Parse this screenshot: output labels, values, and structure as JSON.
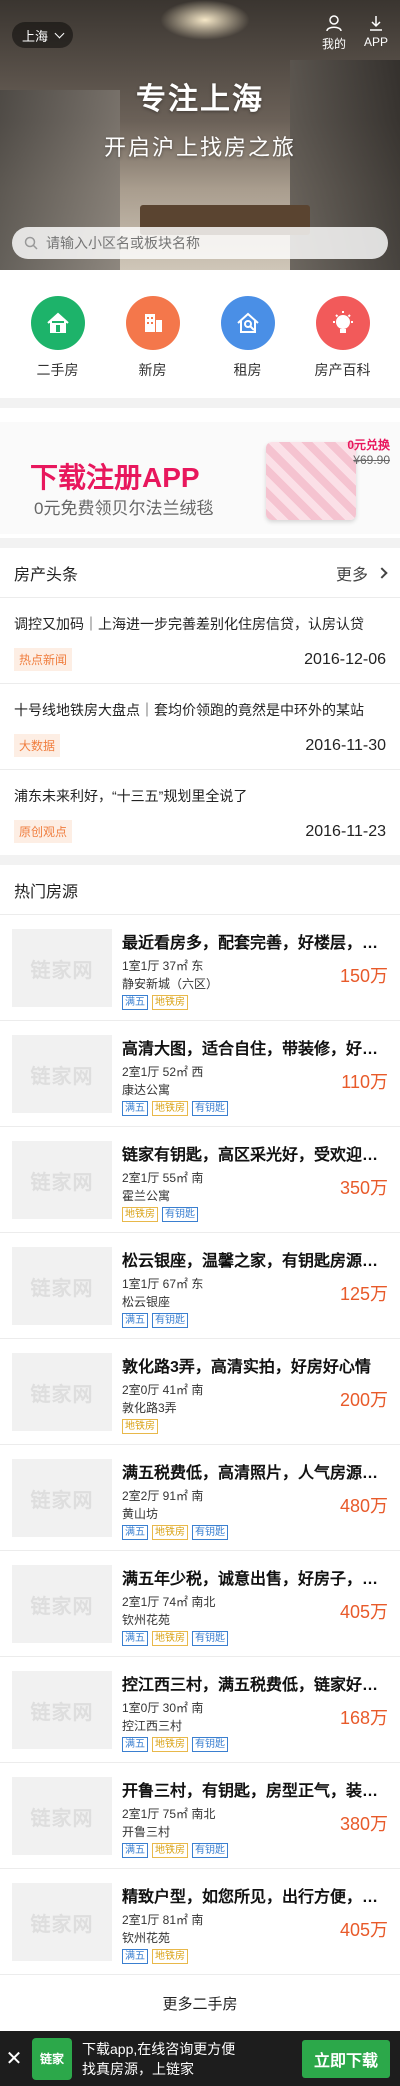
{
  "header": {
    "city": "上海",
    "my_label": "我的",
    "app_label": "APP",
    "title": "专注上海",
    "subtitle": "开启沪上找房之旅",
    "search_placeholder": "请输入小区名或板块名称"
  },
  "categories": [
    {
      "label": "二手房",
      "icon": "house-icon",
      "color": "#1db36a"
    },
    {
      "label": "新房",
      "icon": "building-icon",
      "color": "#f4774b"
    },
    {
      "label": "租房",
      "icon": "key-house-icon",
      "color": "#4a8fe6"
    },
    {
      "label": "房产百科",
      "icon": "bulb-icon",
      "color": "#f25a5a"
    }
  ],
  "banner": {
    "title": "下载注册APP",
    "subtitle": "0元免费领贝尔法兰绒毯",
    "promo_price": "0元兑换",
    "promo_original": "¥69.90"
  },
  "news": {
    "title": "房产头条",
    "more": "更多",
    "items": [
      {
        "title": "调控又加码｜上海进一步完善差别化住房信贷，认房认贷",
        "tag": "热点新闻",
        "date": "2016-12-06"
      },
      {
        "title": "十号线地铁房大盘点｜套均价领跑的竟然是中环外的某站",
        "tag": "大数据",
        "date": "2016-11-30"
      },
      {
        "title": "浦东未来利好，“十三五”规划里全说了",
        "tag": "原创观点",
        "date": "2016-11-23"
      }
    ]
  },
  "listings": {
    "title": "热门房源",
    "thumb_placeholder": "链家网",
    "items": [
      {
        "title": "最近看房多，配套完善，好楼层，采光好",
        "spec": "1室1厅 37㎡ 东",
        "community": "静安新城（六区）",
        "tags": [
          {
            "t": "满五",
            "c": "blue"
          },
          {
            "t": "地铁房",
            "c": "yellow"
          }
        ],
        "price": "150万"
      },
      {
        "title": "高清大图，适合自住，带装修，好楼层",
        "spec": "2室1厅 52㎡ 西",
        "community": "康达公寓",
        "tags": [
          {
            "t": "满五",
            "c": "blue"
          },
          {
            "t": "地铁房",
            "c": "yellow"
          },
          {
            "t": "有钥匙",
            "c": "blue"
          }
        ],
        "price": "110万"
      },
      {
        "title": "链家有钥匙，高区采光好，受欢迎房源",
        "spec": "2室1厅 55㎡ 南",
        "community": "霍兰公寓",
        "tags": [
          {
            "t": "地铁房",
            "c": "yellow"
          },
          {
            "t": "有钥匙",
            "c": "blue"
          }
        ],
        "price": "350万"
      },
      {
        "title": "松云银座，温馨之家，有钥匙房源，随时看",
        "spec": "1室1厅 67㎡ 东",
        "community": "松云银座",
        "tags": [
          {
            "t": "满五",
            "c": "blue"
          },
          {
            "t": "有钥匙",
            "c": "blue"
          }
        ],
        "price": "125万"
      },
      {
        "title": "敦化路3弄，高清实拍，好房好心情",
        "spec": "2室0厅 41㎡ 南",
        "community": "敦化路3弄",
        "tags": [
          {
            "t": "地铁房",
            "c": "yellow"
          }
        ],
        "price": "200万"
      },
      {
        "title": "满五税费低，高清照片，人气房源，看房方便",
        "spec": "2室2厅 91㎡ 南",
        "community": "黄山坊",
        "tags": [
          {
            "t": "满五",
            "c": "blue"
          },
          {
            "t": "地铁房",
            "c": "yellow"
          },
          {
            "t": "有钥匙",
            "c": "blue"
          }
        ],
        "price": "480万"
      },
      {
        "title": "满五年少税，诚意出售，好房子，看房方便",
        "spec": "2室1厅 74㎡ 南北",
        "community": "钦州花苑",
        "tags": [
          {
            "t": "满五",
            "c": "blue"
          },
          {
            "t": "地铁房",
            "c": "yellow"
          },
          {
            "t": "有钥匙",
            "c": "blue"
          }
        ],
        "price": "405万"
      },
      {
        "title": "控江西三村，满五税费低，链家好房源推荐",
        "spec": "1室0厅 30㎡ 南",
        "community": "控江西三村",
        "tags": [
          {
            "t": "满五",
            "c": "blue"
          },
          {
            "t": "地铁房",
            "c": "yellow"
          },
          {
            "t": "有钥匙",
            "c": "blue"
          }
        ],
        "price": "168万"
      },
      {
        "title": "开鲁三村，有钥匙，房型正气，装修保养好",
        "spec": "2室1厅 75㎡ 南北",
        "community": "开鲁三村",
        "tags": [
          {
            "t": "满五",
            "c": "blue"
          },
          {
            "t": "地铁房",
            "c": "yellow"
          },
          {
            "t": "有钥匙",
            "c": "blue"
          }
        ],
        "price": "380万"
      },
      {
        "title": "精致户型，如您所见，出行方便，诚意出售",
        "spec": "2室1厅 81㎡ 南",
        "community": "钦州花苑",
        "tags": [
          {
            "t": "满五",
            "c": "blue"
          },
          {
            "t": "地铁房",
            "c": "yellow"
          }
        ],
        "price": "405万"
      }
    ],
    "more_label": "更多二手房"
  },
  "bottom_bar": {
    "close": "✕",
    "logo": "链家",
    "line1": "下载app,在线咨询更方便",
    "line2": "找真房源，上链家",
    "button": "立即下载"
  }
}
